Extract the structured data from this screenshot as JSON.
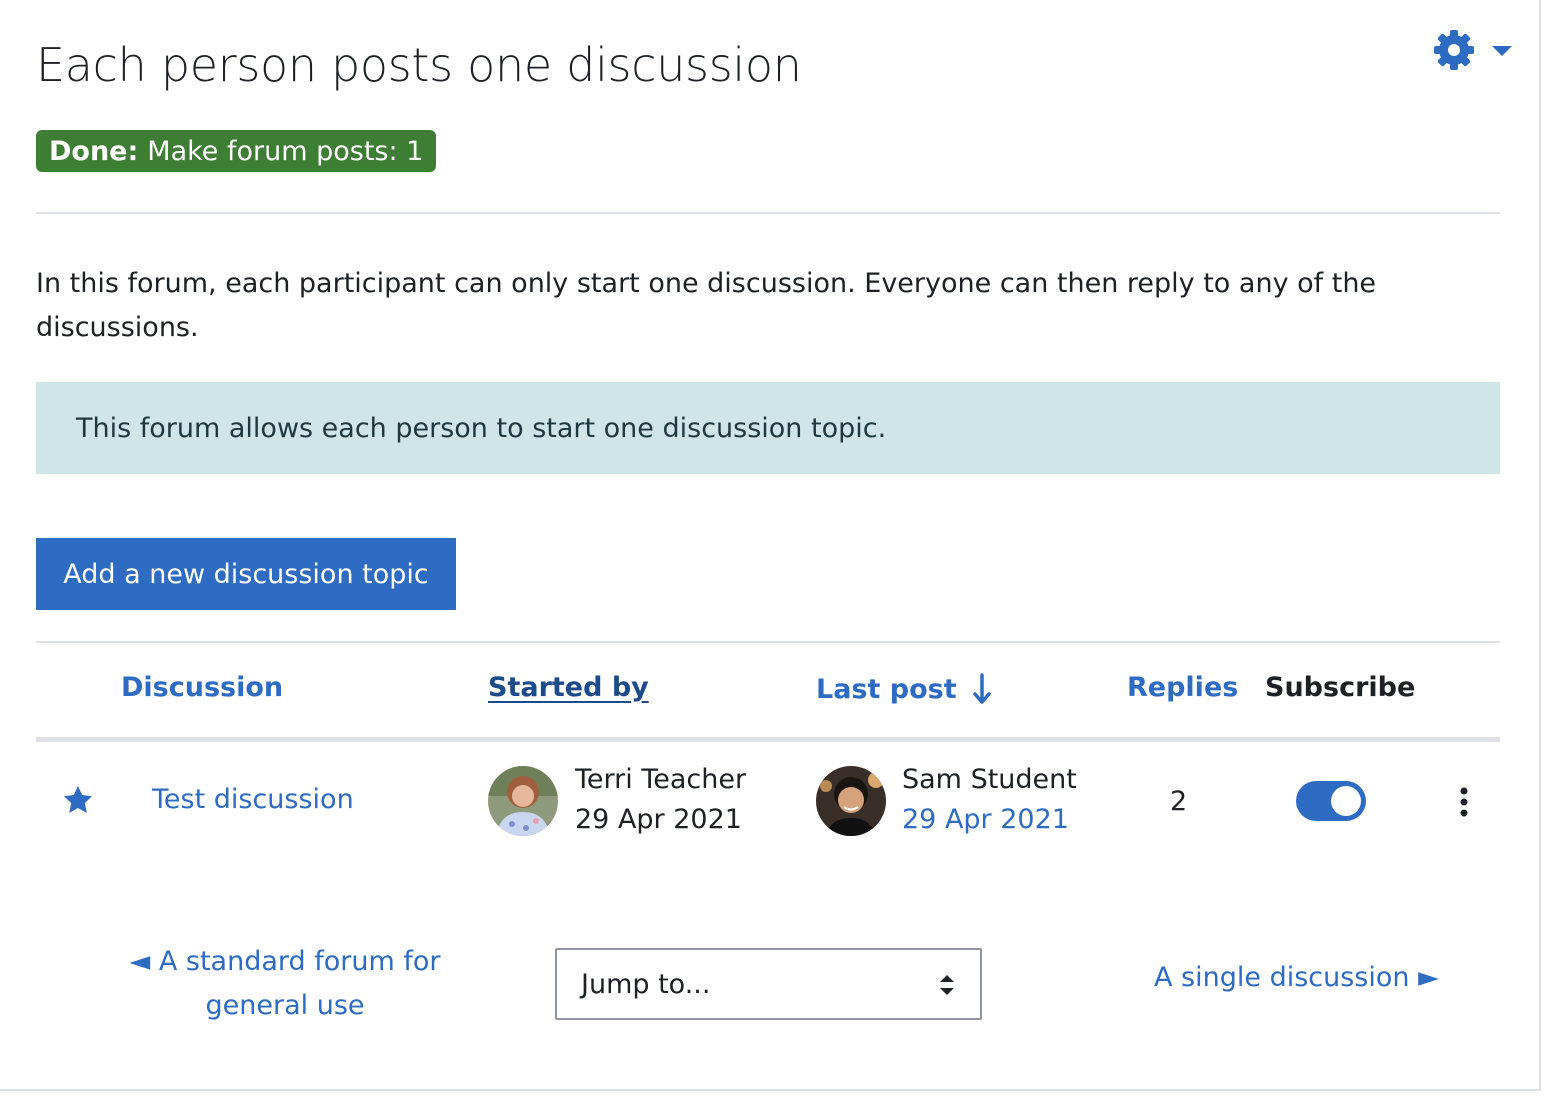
{
  "page": {
    "title": "Each person posts one discussion",
    "completion": {
      "done_label": "Done:",
      "text": "Make forum posts: 1",
      "color": "#3e7d34"
    },
    "intro": "In this forum, each participant can only start one discussion. Everyone can then reply to any of the discussions.",
    "notice": "This forum allows each person to start one discussion topic.",
    "add_button_label": "Add a new discussion topic",
    "accent_color": "#2e6bc2"
  },
  "settings_menu": {
    "icon": "gear-icon",
    "dropdown_icon": "caret-down-icon"
  },
  "table": {
    "headers": {
      "discussion": "Discussion",
      "started_by": "Started by",
      "last_post": "Last post",
      "replies": "Replies",
      "subscribe": "Subscribe"
    },
    "sort_icon": "arrow-down-icon",
    "rows": [
      {
        "starred": true,
        "topic": "Test discussion",
        "started_by": {
          "name": "Terri Teacher",
          "date": "29 Apr 2021"
        },
        "last_post": {
          "name": "Sam Student",
          "date": "29 Apr 2021"
        },
        "replies": "2",
        "subscribed": true
      }
    ]
  },
  "navigation": {
    "prev_label": "◄ A standard forum for general use",
    "jump_placeholder": "Jump to...",
    "next_label": "A single discussion ►"
  }
}
